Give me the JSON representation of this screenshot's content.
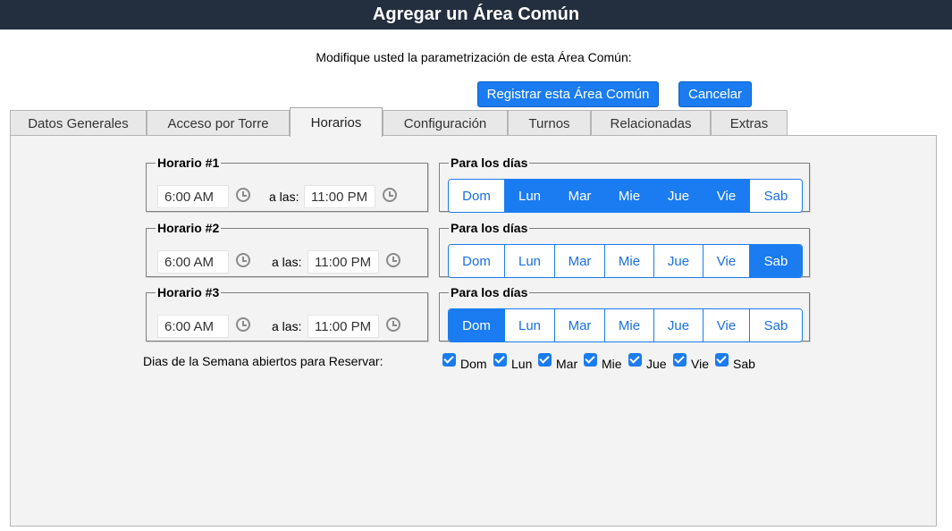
{
  "header": {
    "title": "Agregar un Área Común"
  },
  "subtitle": "Modifique usted la parametrización de esta Área Común:",
  "actions": {
    "register": "Registrar esta Área Común",
    "cancel": "Cancelar"
  },
  "tabs": [
    "Datos Generales",
    "Acceso por Torre",
    "Horarios",
    "Configuración",
    "Turnos",
    "Relacionadas",
    "Extras"
  ],
  "active_tab": "Horarios",
  "days_legend": "Para los días",
  "separator": "a las:",
  "schedules": [
    {
      "legend": "Horario #1",
      "from": "6:00 AM",
      "to": "11:00 PM"
    },
    {
      "legend": "Horario #2",
      "from": "6:00 AM",
      "to": "11:00 PM"
    },
    {
      "legend": "Horario #3",
      "from": "6:00 AM",
      "to": "11:00 PM"
    }
  ],
  "day_names": [
    "Dom",
    "Lun",
    "Mar",
    "Mie",
    "Jue",
    "Vie",
    "Sab"
  ],
  "day_selection": [
    [
      false,
      true,
      true,
      true,
      true,
      true,
      false
    ],
    [
      false,
      false,
      false,
      false,
      false,
      false,
      true
    ],
    [
      true,
      false,
      false,
      false,
      false,
      false,
      false
    ]
  ],
  "week_open": {
    "label": "Dias de la Semana abiertos para Reservar:",
    "days": [
      {
        "name": "Dom",
        "checked": true
      },
      {
        "name": "Lun",
        "checked": true
      },
      {
        "name": "Mar",
        "checked": true
      },
      {
        "name": "Mie",
        "checked": true
      },
      {
        "name": "Jue",
        "checked": true
      },
      {
        "name": "Vie",
        "checked": true
      },
      {
        "name": "Sab",
        "checked": true
      }
    ]
  },
  "icons": {
    "time": "clock-icon",
    "check": "checkbox-checked-icon"
  },
  "colors": {
    "header_bg": "#232f3e",
    "accent": "#1a7cf0",
    "panel_bg": "#f3f3f3"
  }
}
